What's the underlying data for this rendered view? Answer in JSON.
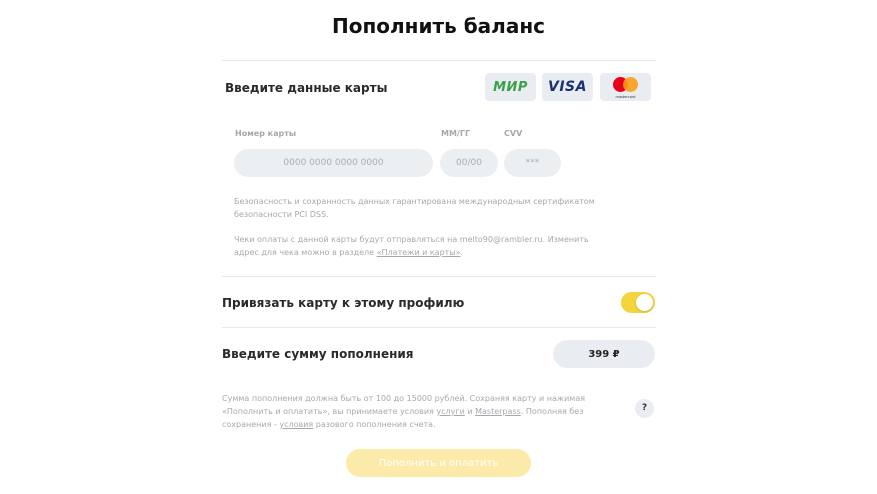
{
  "page": {
    "title": "Пополнить баланс"
  },
  "card_section": {
    "label": "Введите данные карты",
    "logos": [
      {
        "name": "МИР",
        "icon": "mir-logo-icon"
      },
      {
        "name": "VISA",
        "icon": "visa-logo-icon"
      },
      {
        "name": "mastercard",
        "icon": "mastercard-logo-icon"
      }
    ],
    "fields": {
      "card_number": {
        "label": "Номер карты",
        "placeholder": "0000 0000 0000 0000",
        "value": ""
      },
      "expiry": {
        "label": "ММ/ГГ",
        "placeholder": "00/00",
        "value": ""
      },
      "cvv": {
        "label": "CVV",
        "placeholder": "***",
        "value": ""
      }
    },
    "security_note": {
      "line1": "Безопасность и сохранность данных гарантирована международным сертификатом",
      "line2": "безопасности PCI DSS."
    },
    "receipt_note": {
      "line1": "Чеки оплаты с данной карты будут отправляться на melto90@rambler.ru. Изменить",
      "line2_prefix": "адрес для чека можно в разделе ",
      "link": "«Платежи и карты»",
      "line2_suffix": "."
    }
  },
  "bind_card": {
    "label": "Привязать карту к этому профилю",
    "enabled": true,
    "toggle_color": "#f3d43b"
  },
  "amount": {
    "label": "Введите сумму пополнения",
    "value": "399 ₽"
  },
  "terms": {
    "line1": "Сумма пополнения должна быть от 100 до 15000 рублей. Сохраняя карту и нажимая",
    "line2_a": "«Пополнить и оплатить», вы принимаете условия ",
    "link_services": "услуги",
    "line2_b": " и ",
    "link_masterpass": "Masterpass",
    "line2_c": ". Пополняя без",
    "line3_a": "сохранения - ",
    "link_conditions": "условия",
    "line3_b": " разового пополнения счета.",
    "help": "?"
  },
  "submit": {
    "label": "Пополнить и оплатить",
    "color": "#fbeaa9"
  }
}
